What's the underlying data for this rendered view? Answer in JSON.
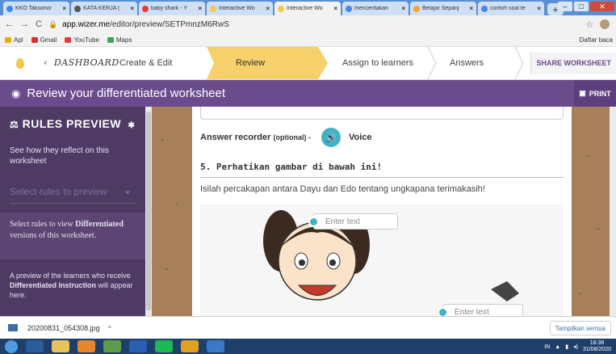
{
  "browser": {
    "tabs": [
      {
        "label": "KKO Taksonor",
        "color": "#4285f4"
      },
      {
        "label": "KATA KERJA (",
        "color": "#555555"
      },
      {
        "label": "baby shark - Y",
        "color": "#e53935"
      },
      {
        "label": "Interactive Wo",
        "color": "#f2c94c"
      },
      {
        "label": "Interactive Wo",
        "color": "#f2c94c",
        "active": true
      },
      {
        "label": "menceritakan",
        "color": "#4285f4"
      },
      {
        "label": "Belajar Sepanj",
        "color": "#f4a233"
      },
      {
        "label": "contoh soal te",
        "color": "#4285f4"
      }
    ],
    "new_tab": "+",
    "url_host": "app.wizer.me",
    "url_path": "/editor/preview/SETPmnzM6RwS",
    "bookmarks": [
      {
        "label": "Apl",
        "color": "#e0b000"
      },
      {
        "label": "Gmail",
        "color": "#d93025"
      },
      {
        "label": "YouTube",
        "color": "#e53935"
      },
      {
        "label": "Maps",
        "color": "#34a853"
      }
    ],
    "bookmarks_right": "Daftar baca"
  },
  "appnav": {
    "dashboard": "DASHBOARD",
    "steps": [
      "Create & Edit",
      "Review",
      "Assign to learners",
      "Answers"
    ],
    "share": "SHARE WORKSHEET"
  },
  "header": {
    "title": "Review your differentiated worksheet",
    "print": "PRINT"
  },
  "sidebar": {
    "title": "RULES PREVIEW",
    "desc": "See how they reflect on this worksheet",
    "select_placeholder": "Select rules to preview",
    "box1_pre": "Select rules to view ",
    "box1_bold": "Differentiated",
    "box1_post": " versions of this worksheet.",
    "box2_pre": "A preview of the learners who receive ",
    "box2_bold": "Differentiated Instruction",
    "box2_post": " will appear here."
  },
  "worksheet": {
    "recorder_label": "Answer recorder",
    "recorder_optional": "(optional) -",
    "voice": "Voice",
    "question_title": "5. Perhatikan gambar di bawah ini!",
    "question_text": "Isilah percakapan antara Dayu dan Edo tentang ungkapana terimakasih!",
    "input1": "Enter text",
    "input2": "Enter text"
  },
  "downloads": {
    "file": "20200831_054308.jpg",
    "show_all": "Tampilkan semua"
  },
  "taskbar": {
    "lang": "IN",
    "time": "18:38",
    "date": "31/08/2020"
  }
}
